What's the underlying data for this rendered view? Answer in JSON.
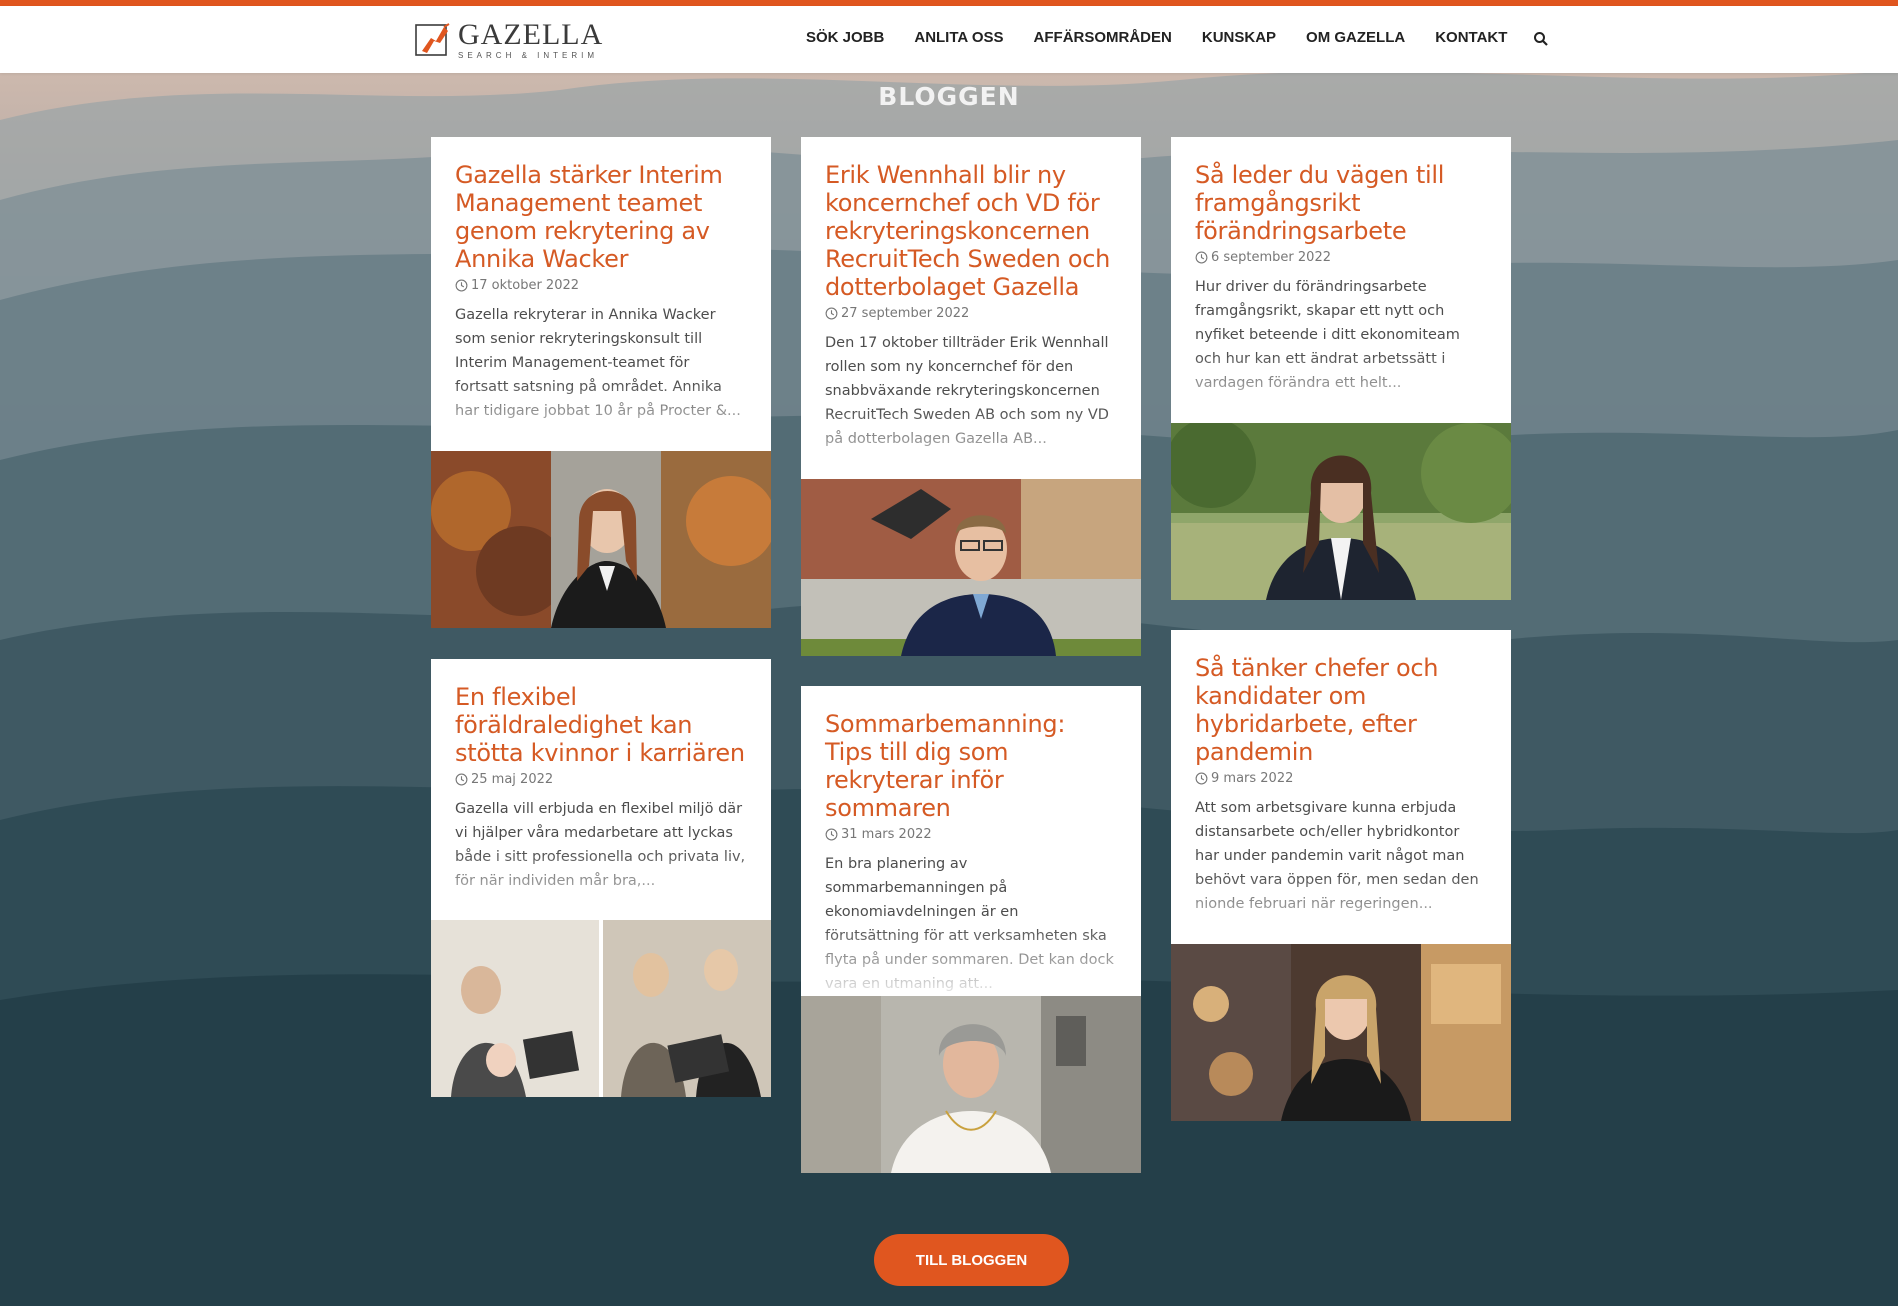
{
  "header": {
    "logo": {
      "name": "GAZELLA",
      "tagline": "SEARCH & INTERIM"
    },
    "nav": [
      {
        "label": "SÖK JOBB"
      },
      {
        "label": "ANLITA OSS"
      },
      {
        "label": "AFFÄRSOMRÅDEN"
      },
      {
        "label": "KUNSKAP"
      },
      {
        "label": "OM GAZELLA"
      },
      {
        "label": "KONTAKT"
      }
    ],
    "search_icon": "search-icon"
  },
  "blog": {
    "title": "BLOGGEN",
    "posts": [
      {
        "title": "Gazella stärker Interim Management teamet genom rekrytering av Annika Wacker",
        "date": "17 oktober 2022",
        "excerpt": "Gazella rekryterar in Annika Wacker som senior rekryteringskonsult till Interim Management-teamet för fortsatt satsning på området. Annika har tidigare jobbat 10 år på Procter &..."
      },
      {
        "title": "Erik Wennhall blir ny koncernchef och VD för rekryteringskoncernen RecruitTech Sweden och dotterbolaget Gazella",
        "date": "27 september 2022",
        "excerpt": "Den 17 oktober tillträder Erik Wennhall rollen som ny koncernchef för den snabbväxande rekryteringskoncernen RecruitTech Sweden AB och som ny VD på dotterbolagen Gazella AB..."
      },
      {
        "title": "Så leder du vägen till framgångsrikt förändringsarbete",
        "date": "6 september 2022",
        "excerpt": "Hur driver du förändringsarbete framgångsrikt, skapar ett nytt och nyfiket beteende i ditt ekonomiteam och hur kan ett ändrat arbetssätt i vardagen förändra ett helt..."
      },
      {
        "title": "En flexibel föräldraledighet kan stötta kvinnor i karriären",
        "date": "25 maj 2022",
        "excerpt": "Gazella vill erbjuda en flexibel miljö där vi hjälper våra medarbetare att lyckas både i sitt professionella och privata liv, för när individen mår bra,..."
      },
      {
        "title": "Sommarbemanning: Tips till dig som rekryterar inför sommaren",
        "date": "31 mars 2022",
        "excerpt": "En bra planering av sommarbemanningen på ekonomiavdelningen är en förutsättning för att verksamheten ska flyta på under sommaren. Det kan dock vara en utmaning att..."
      },
      {
        "title": "Så tänker chefer och kandidater om hybridarbete, efter pandemin",
        "date": "9 mars 2022",
        "excerpt": "Att som arbetsgivare kunna erbjuda distansarbete och/eller hybridkontor har under pandemin varit något man behövt vara öppen för, men sedan den nionde februari när regeringen..."
      }
    ],
    "cta": "TILL BLOGGEN"
  },
  "colors": {
    "accent": "#e0561f",
    "title": "#d55a24"
  }
}
